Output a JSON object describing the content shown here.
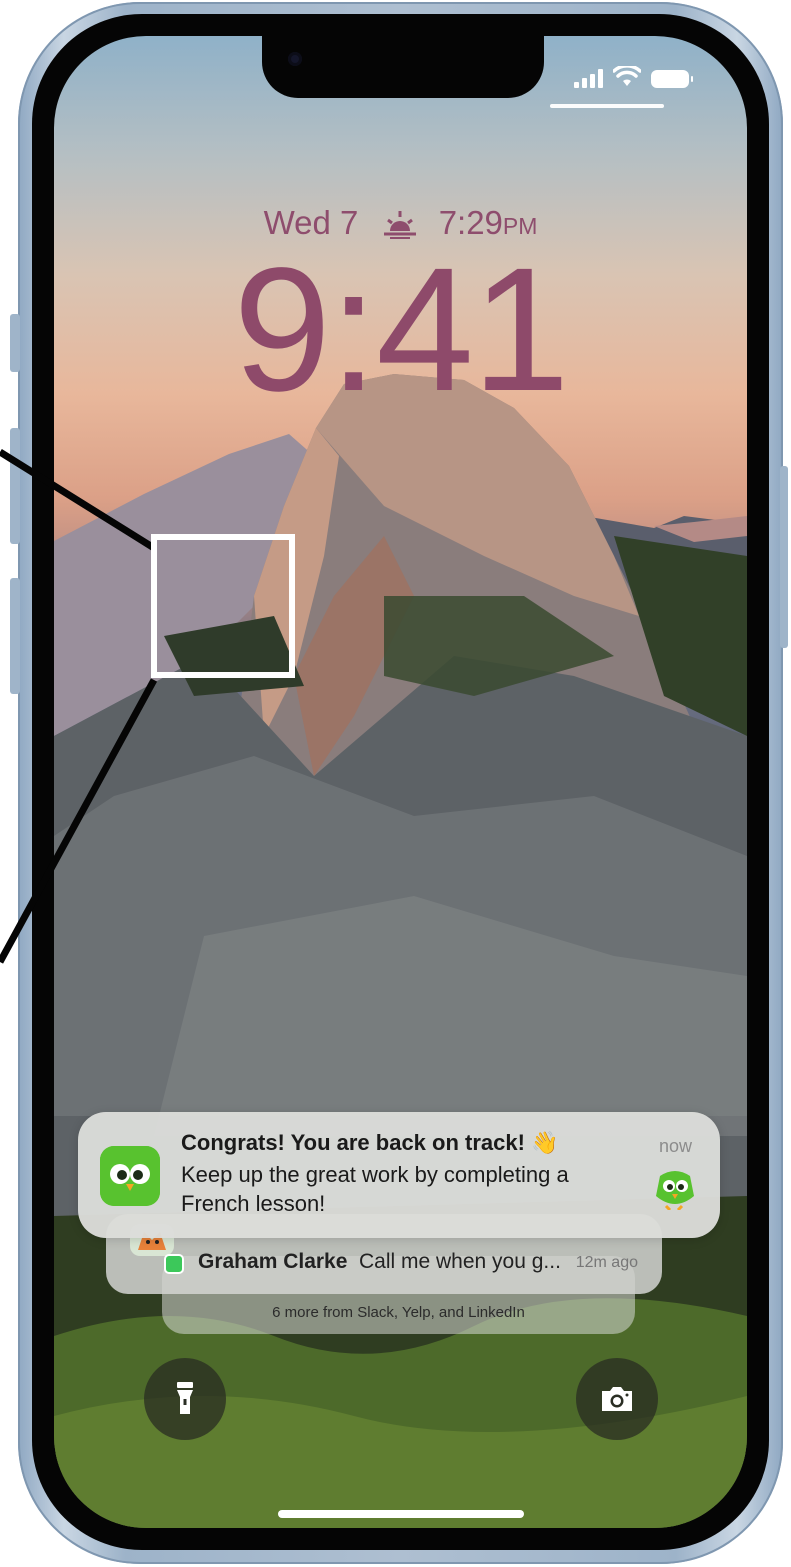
{
  "lockscreen": {
    "date": "Wed 7",
    "sunset_time": "7:29",
    "sunset_suffix": "PM",
    "clock": "9:41"
  },
  "status_bar": {
    "icons": [
      "signal-icon",
      "wifi-icon",
      "battery-icon"
    ]
  },
  "notifications": {
    "duolingo": {
      "title": "Congrats! You are back on track! 👋",
      "body": "Keep up the great work by completing a French lesson!",
      "time": "now"
    },
    "message": {
      "sender": "Graham Clarke",
      "text": "Call me when you g...",
      "time": "12m ago"
    },
    "more": "6 more from Slack, Yelp, and LinkedIn"
  },
  "quick_actions": {
    "left": "flashlight-icon",
    "right": "camera-icon"
  },
  "colors": {
    "clock": "#8e4a6a",
    "duolingo_green": "#58c22f",
    "messages_green": "#3cc85a"
  }
}
